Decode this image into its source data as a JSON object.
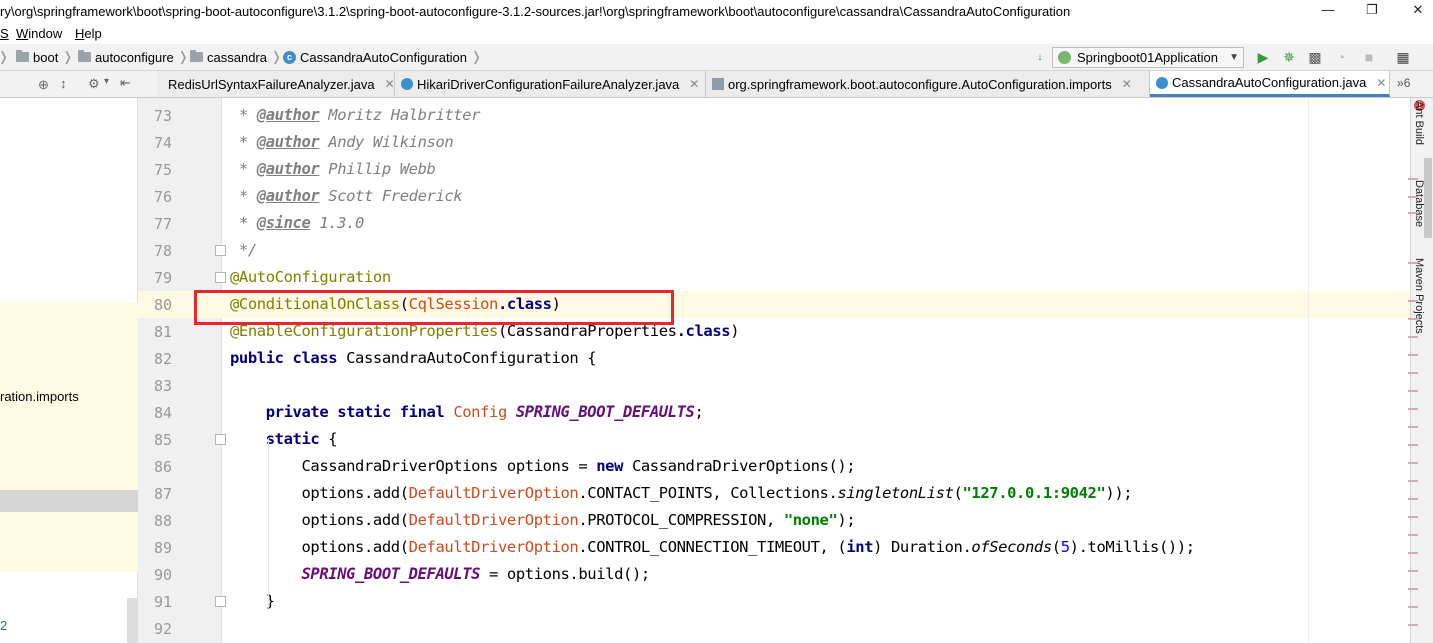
{
  "title_bar": {
    "path": "ry\\org\\springframework\\boot\\spring-boot-autoconfigure\\3.1.2\\spring-boot-autoconfigure-3.1.2-sources.jar!\\org\\springframework\\boot\\autoconfigure\\cassandra\\CassandraAutoConfiguration",
    "minimize": "—",
    "maximize": "❐",
    "close": "✕"
  },
  "menu": {
    "partial_item": "S",
    "window": "Window",
    "window_mnemonic": "W",
    "window_rest": "indow",
    "help": "Help",
    "help_mnemonic": "H",
    "help_rest": "elp"
  },
  "breadcrumb": {
    "items": [
      "boot",
      "autoconfigure",
      "cassandra",
      "CassandraAutoConfiguration"
    ]
  },
  "toolbar": {
    "run_config": "Springboot01Application",
    "tab_overflow": "6"
  },
  "tabs": [
    {
      "label": "RedisUrlSyntaxFailureAnalyzer.java",
      "active": false
    },
    {
      "label": "HikariDriverConfigurationFailureAnalyzer.java",
      "active": false
    },
    {
      "label": "org.springframework.boot.autoconfigure.AutoConfiguration.imports",
      "active": false
    },
    {
      "label": "CassandraAutoConfiguration.java",
      "active": true
    }
  ],
  "left_panel": {
    "partial_item": "ration.imports",
    "bottom_partial": "2"
  },
  "right_tool_windows": [
    "Ant Build",
    "Database",
    "Maven Projects"
  ],
  "editor": {
    "current_line": 80,
    "lines": [
      {
        "n": "73",
        "author_tag": "@author",
        "doc": " Moritz Halbritter"
      },
      {
        "n": "74",
        "author_tag": "@author",
        "doc": " Andy Wilkinson"
      },
      {
        "n": "75",
        "author_tag": "@author",
        "doc": " Phillip Webb"
      },
      {
        "n": "76",
        "author_tag": "@author",
        "doc": " Scott Frederick"
      },
      {
        "n": "77",
        "author_tag": "@since",
        "doc": " 1.3.0"
      },
      {
        "n": "78"
      },
      {
        "n": "79"
      },
      {
        "n": "80"
      },
      {
        "n": "81"
      },
      {
        "n": "82"
      },
      {
        "n": "83"
      },
      {
        "n": "84"
      },
      {
        "n": "85"
      },
      {
        "n": "86"
      },
      {
        "n": "87"
      },
      {
        "n": "88"
      },
      {
        "n": "89"
      },
      {
        "n": "90"
      },
      {
        "n": "91"
      },
      {
        "n": "92"
      }
    ],
    "tokens": {
      "doc_star": " * ",
      "doc_end": " */",
      "ann_autoconfig": "@AutoConfiguration",
      "ann_conditional": "@ConditionalOnClass",
      "cql_session": "CqlSession",
      "dot_class": ".class",
      "ann_enable": "@EnableConfigurationProperties",
      "cassandra_props": "CassandraProperties",
      "kw_public_class": "public class",
      "class_name": " CassandraAutoConfiguration {",
      "kw_private_static_final": "private static final",
      "config_type": "Config",
      "const_defaults": "SPRING_BOOT_DEFAULTS",
      "kw_static": "static",
      "brace_open": " {",
      "driver_options_decl": "CassandraDriverOptions options = ",
      "kw_new": "new",
      "driver_options_ctor": " CassandraDriverOptions();",
      "options_add": "options.add(",
      "default_driver_option": "DefaultDriverOption",
      "contact_points": ".CONTACT_POINTS, Collections.",
      "singleton_list": "singletonList",
      "str_contact": "\"127.0.0.1:9042\"",
      "close_two": "));",
      "protocol_compression": ".PROTOCOL_COMPRESSION, ",
      "str_none": "\"none\"",
      "close_one": ");",
      "control_timeout": ".CONTROL_CONNECTION_TIMEOUT, (",
      "kw_int": "int",
      "duration": ") Duration.",
      "of_seconds": "ofSeconds",
      "num_5": "5",
      "to_millis": ").toMillis());",
      "build": " = options.build();",
      "brace_close": "}"
    }
  },
  "colors": {
    "highlight_box": "#e8262b",
    "current_line_bg": "#fffae3",
    "active_tab_underline": "#4083c9"
  }
}
